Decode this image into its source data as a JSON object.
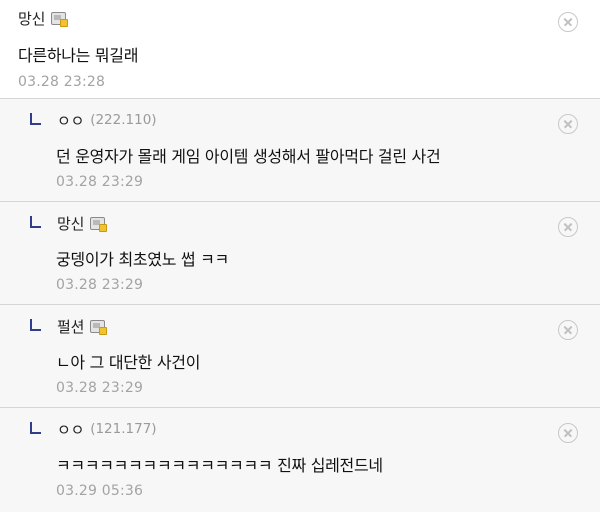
{
  "comments": [
    {
      "nickname": "망신",
      "ip": "",
      "text": "다른하나는 뭐길래",
      "date": "03.28 23:28"
    },
    {
      "nickname": "ㅇㅇ",
      "ip": "(222.110)",
      "text": "던 운영자가 몰래 게임 아이템 생성해서 팔아먹다 걸린 사건",
      "date": "03.28 23:29"
    },
    {
      "nickname": "망신",
      "ip": "",
      "text": "궁뎅이가 최초였노 썹 ㅋㅋ",
      "date": "03.28 23:29"
    },
    {
      "nickname": "펄션",
      "ip": "",
      "text": "ㄴ아 그 대단한 사건이",
      "date": "03.28 23:29"
    },
    {
      "nickname": "ㅇㅇ",
      "ip": "(121.177)",
      "text": "ㅋㅋㅋㅋㅋㅋㅋㅋㅋㅋㅋㅋㅋㅋㅋ 진짜 십레전드네",
      "date": "03.29 05:36"
    }
  ],
  "colors": {
    "reply_marker": "#2e3d8c",
    "date_text": "#a3a3a3",
    "ip_text": "#9a9a9a",
    "divider": "#d6d6d6"
  },
  "icons": {
    "member": "member-badge-icon",
    "delete": "delete-circle-x-icon",
    "reply": "reply-arrow-icon"
  }
}
